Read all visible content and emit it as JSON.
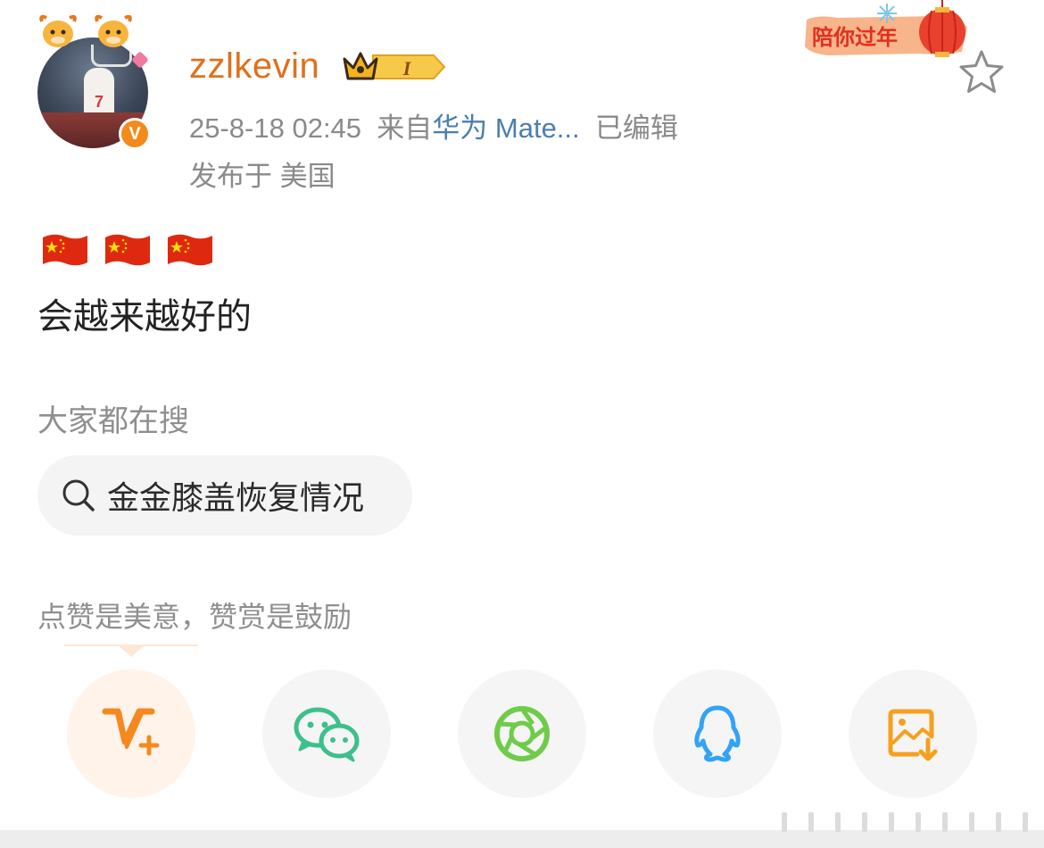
{
  "post": {
    "username": "zzlkevin",
    "vip_level": "I",
    "time": "25-8-18 02:45",
    "source_prefix": "来自",
    "source": "华为 Mate...",
    "edited": "已编辑",
    "location": "发布于 美国",
    "flags": [
      "cn-flag",
      "cn-flag",
      "cn-flag"
    ],
    "text": "会越来越好的"
  },
  "festival_badge": {
    "text": "陪你过年"
  },
  "search": {
    "label": "大家都在搜",
    "query": "金金膝盖恢复情况"
  },
  "reward": {
    "text": "点赞是美意，赞赏是鼓励"
  },
  "share_buttons": [
    {
      "name": "vplus-reward",
      "icon": "vplus-icon"
    },
    {
      "name": "wechat",
      "icon": "wechat-icon"
    },
    {
      "name": "moments",
      "icon": "moments-icon"
    },
    {
      "name": "qq",
      "icon": "qq-icon"
    },
    {
      "name": "save-image",
      "icon": "save-image-icon"
    }
  ],
  "colors": {
    "username": "#e0701c",
    "link": "#4a7eb0",
    "muted": "#8a8a8a",
    "accent_orange": "#f5891f",
    "wechat_green": "#3cc08c",
    "moments_green": "#6fcb4a",
    "qq_blue": "#33a3f4"
  }
}
